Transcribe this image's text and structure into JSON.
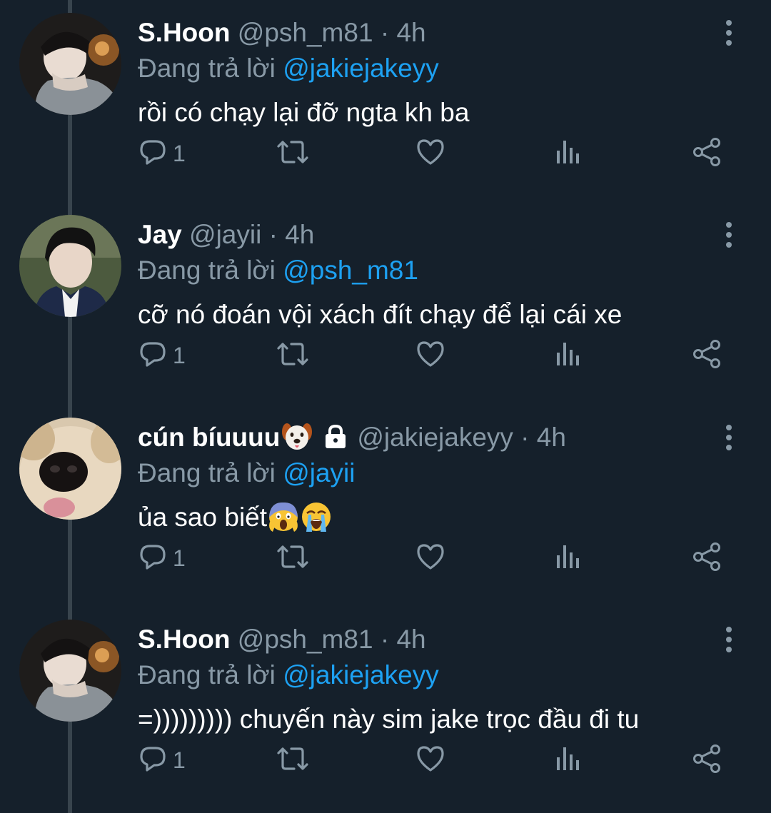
{
  "tweets": [
    {
      "display_name": "S.Hoon",
      "handle": "@psh_m81",
      "separator": "·",
      "time": "4h",
      "replying_prefix": "Đang trả lời",
      "replying_to": "@jakiejakeyy",
      "text": "rồi có chạy lại đỡ ngta kh ba",
      "reply_count": "1"
    },
    {
      "display_name": "Jay",
      "handle": "@jayii",
      "separator": "·",
      "time": "4h",
      "replying_prefix": "Đang trả lời",
      "replying_to": "@psh_m81",
      "text": "cỡ nó đoán vội xách đít chạy để lại cái xe",
      "reply_count": "1"
    },
    {
      "display_name": "cún bíuuuu",
      "handle": "@jakiejakeyy",
      "separator": "·",
      "time": "4h",
      "replying_prefix": "Đang trả lời",
      "replying_to": "@jayii",
      "text": "ủa sao biết",
      "reply_count": "1",
      "name_emoji": "dog-face-emoji",
      "protected": "lock-icon",
      "text_emojis": [
        "face-screaming-in-fear-emoji",
        "loudly-crying-face-emoji"
      ]
    },
    {
      "display_name": "S.Hoon",
      "handle": "@psh_m81",
      "separator": "·",
      "time": "4h",
      "replying_prefix": "Đang trả lời",
      "replying_to": "@jakiejakeyy",
      "text": "=))))))))) chuyến này sim jake trọc đầu đi tu",
      "reply_count": "1"
    }
  ],
  "icons": {
    "reply": "reply-icon",
    "retweet": "retweet-icon",
    "like": "like-icon",
    "analytics": "analytics-icon",
    "share": "share-icon",
    "more": "more-vertical-icon"
  },
  "colors": {
    "background": "#15202b",
    "thread_line": "#38444d",
    "secondary_text": "#8899a6",
    "mention": "#1da1f2",
    "primary_text": "#ffffff"
  }
}
